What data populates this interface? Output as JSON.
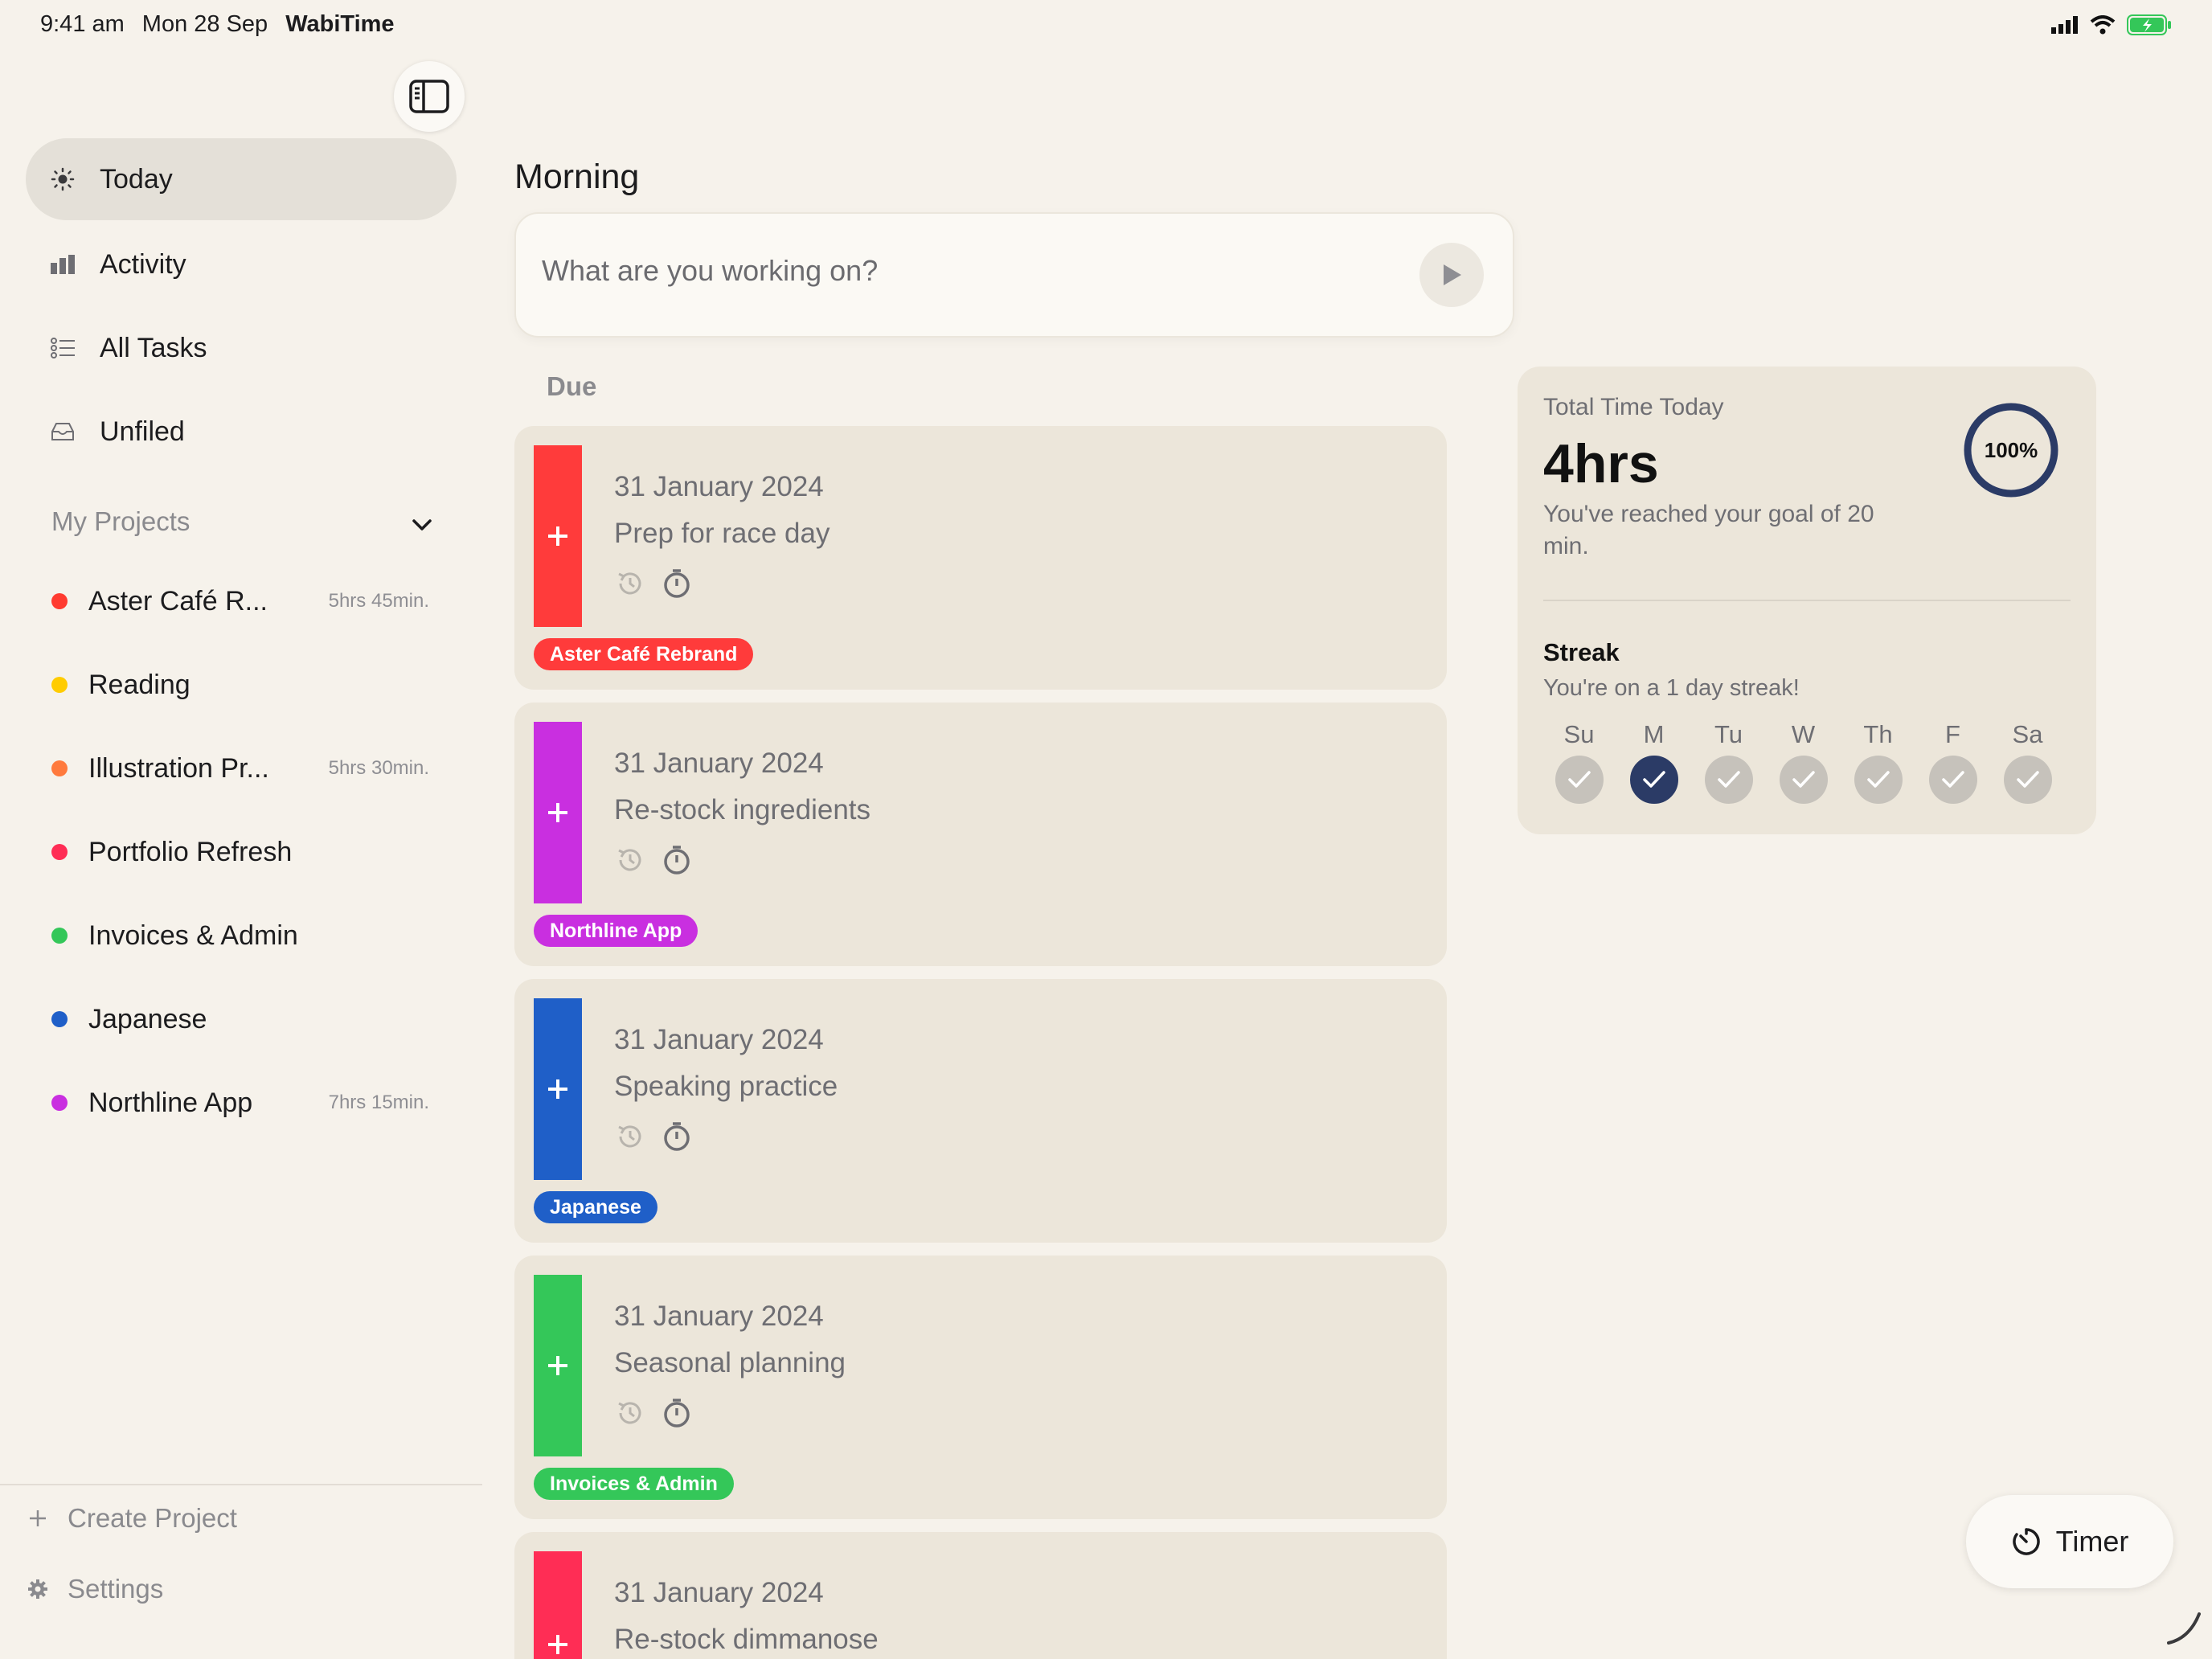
{
  "status_bar": {
    "time": "9:41 am",
    "date": "Mon 28 Sep",
    "app_name": "WabiTime"
  },
  "sidebar": {
    "nav": [
      {
        "label": "Today",
        "icon": "sun-icon",
        "active": true
      },
      {
        "label": "Activity",
        "icon": "bar-chart-icon",
        "active": false
      },
      {
        "label": "All Tasks",
        "icon": "checklist-icon",
        "active": false
      },
      {
        "label": "Unfiled",
        "icon": "inbox-icon",
        "active": false
      }
    ],
    "projects_title": "My Projects",
    "projects": [
      {
        "name": "Aster Café R...",
        "time": "5hrs 45min.",
        "color": "#ff3b30"
      },
      {
        "name": "Reading",
        "time": "",
        "color": "#ffcc00"
      },
      {
        "name": "Illustration Pr...",
        "time": "5hrs 30min.",
        "color": "#ff7a3d"
      },
      {
        "name": "Portfolio Refresh",
        "time": "",
        "color": "#ff2d55"
      },
      {
        "name": "Invoices & Admin",
        "time": "",
        "color": "#34c759"
      },
      {
        "name": "Japanese",
        "time": "",
        "color": "#1f5fc8"
      },
      {
        "name": "Northline App",
        "time": "7hrs 15min.",
        "color": "#c92fe0"
      }
    ],
    "create_project": "Create Project",
    "settings": "Settings"
  },
  "main": {
    "section": "Morning",
    "input_placeholder": "What are you working on?",
    "due_label": "Due",
    "tasks": [
      {
        "date": "31 January 2024",
        "title": "Prep for race day",
        "tag": "Aster Café Rebrand",
        "color": "#ff3b3b"
      },
      {
        "date": "31 January 2024",
        "title": "Re-stock ingredients",
        "tag": "Northline App",
        "color": "#c92fe0"
      },
      {
        "date": "31 January 2024",
        "title": "Speaking practice",
        "tag": "Japanese",
        "color": "#1f5fc8"
      },
      {
        "date": "31 January 2024",
        "title": "Seasonal planning",
        "tag": "Invoices & Admin",
        "color": "#34c759"
      },
      {
        "date": "31 January 2024",
        "title": "Re-stock dimmanose",
        "tag": "",
        "color": "#ff2d55"
      }
    ]
  },
  "stats": {
    "title": "Total Time Today",
    "total": "4hrs",
    "goal_text": "You've reached your goal of 20 min.",
    "progress_percent": 100,
    "progress_label": "100%",
    "streak_title": "Streak",
    "streak_text": "You're on a 1 day streak!",
    "days": [
      {
        "label": "Su",
        "active": false
      },
      {
        "label": "M",
        "active": true
      },
      {
        "label": "Tu",
        "active": false
      },
      {
        "label": "W",
        "active": false
      },
      {
        "label": "Th",
        "active": false
      },
      {
        "label": "F",
        "active": false
      },
      {
        "label": "Sa",
        "active": false
      }
    ]
  },
  "timer_button": "Timer"
}
